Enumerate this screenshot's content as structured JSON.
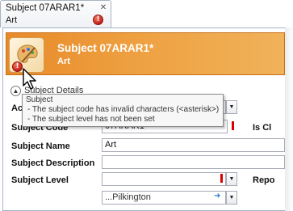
{
  "tab": {
    "title": "Subject 07ARAR1*",
    "subtitle": "Art",
    "close_glyph": "✕",
    "error_glyph": "!"
  },
  "header": {
    "title": "Subject 07ARAR1*",
    "subtitle": "Art",
    "logo_icon": "palette-icon",
    "error_glyph": "!"
  },
  "section": {
    "label": "Subject Details",
    "toggle_glyph": "▲"
  },
  "tooltip": {
    "title": "Subject",
    "lines": [
      "- The subject code has invalid characters (<asterisk>)",
      "- The subject level has not been set"
    ]
  },
  "form": {
    "active_label": "Ac",
    "code_label": "Subject Code",
    "code_value": "07ARAR1",
    "is_label": "Is Cl",
    "name_label": "Subject Name",
    "name_value": "Art",
    "description_label": "Subject Description",
    "description_value": "",
    "level_label": "Subject Level",
    "level_value": "",
    "report_label": "Repo",
    "teacher_value": "...Pilkington"
  },
  "colors": {
    "header_accent": "#eea040",
    "error": "#c4201b",
    "required_marker": "#d80000",
    "link_arrow": "#2e7bd1"
  }
}
